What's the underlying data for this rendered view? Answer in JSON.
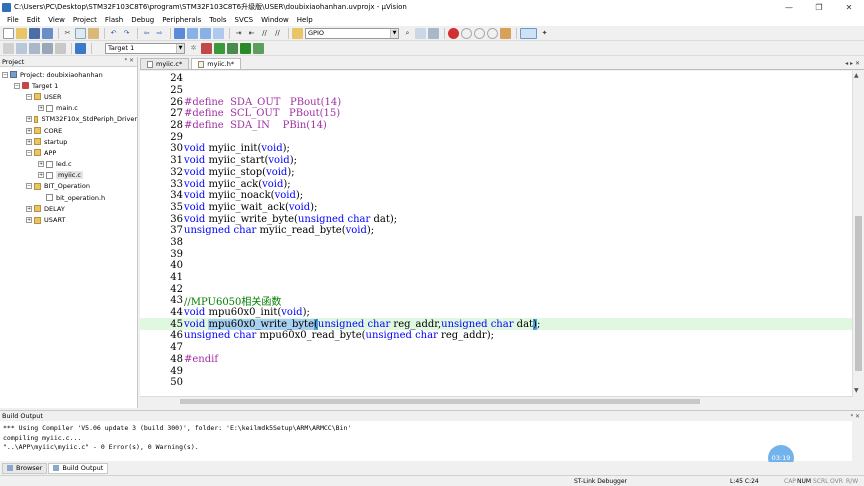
{
  "window": {
    "title": "C:\\Users\\PC\\Desktop\\STM32F103C8T6\\program\\STM32F103C8T6升级版\\USER\\doubixiaohanhan.uvprojx - µVision",
    "controls": [
      "—",
      "❐",
      "✕"
    ]
  },
  "menu": [
    "File",
    "Edit",
    "View",
    "Project",
    "Flash",
    "Debug",
    "Peripherals",
    "Tools",
    "SVCS",
    "Window",
    "Help"
  ],
  "toolbar": {
    "search_value": "GPIO",
    "target_value": "Target 1"
  },
  "project_panel": {
    "title": "Project",
    "header_buttons": "ᵠ ✕",
    "tree": [
      {
        "label": "Project: doubixiaohanhan",
        "level": 0,
        "icon": "project-icon",
        "expander": "−"
      },
      {
        "label": "Target 1",
        "level": 1,
        "icon": "target-icon",
        "expander": "−"
      },
      {
        "label": "USER",
        "level": 2,
        "icon": "folder-icon",
        "expander": "−"
      },
      {
        "label": "main.c",
        "level": 3,
        "icon": "file-icon",
        "expander": "+"
      },
      {
        "label": "STM32F10x_StdPeriph_Driver",
        "level": 2,
        "icon": "folder-icon",
        "expander": "+"
      },
      {
        "label": "CORE",
        "level": 2,
        "icon": "folder-icon",
        "expander": "+"
      },
      {
        "label": "startup",
        "level": 2,
        "icon": "folder-icon",
        "expander": "+"
      },
      {
        "label": "APP",
        "level": 2,
        "icon": "folder-icon",
        "expander": "−"
      },
      {
        "label": "led.c",
        "level": 3,
        "icon": "file-icon",
        "expander": "+"
      },
      {
        "label": "myiic.c",
        "level": 3,
        "icon": "file-icon",
        "expander": "+",
        "selected": true
      },
      {
        "label": "BIT_Operation",
        "level": 2,
        "icon": "folder-icon",
        "expander": "−"
      },
      {
        "label": "bit_operation.h",
        "level": 3,
        "icon": "file-icon",
        "expander": ""
      },
      {
        "label": "DELAY",
        "level": 2,
        "icon": "folder-icon",
        "expander": "+"
      },
      {
        "label": "USART",
        "level": 2,
        "icon": "folder-icon",
        "expander": "+"
      }
    ]
  },
  "editor": {
    "tabs": [
      {
        "label": "myiic.c*",
        "active": false
      },
      {
        "label": "myiic.h*",
        "active": true
      }
    ],
    "tab_scroll": "◂ ▸ ✕",
    "lines": [
      {
        "n": "24",
        "parts": []
      },
      {
        "n": "25",
        "parts": []
      },
      {
        "n": "26",
        "parts": [
          {
            "t": "#define  SDA_OUT   PBout(14)",
            "c": "kw2"
          }
        ]
      },
      {
        "n": "27",
        "parts": [
          {
            "t": "#define  SCL_OUT   PBout(15)",
            "c": "kw2"
          }
        ]
      },
      {
        "n": "28",
        "parts": [
          {
            "t": "#define  SDA_IN    PBin(14)",
            "c": "kw2"
          }
        ]
      },
      {
        "n": "29",
        "parts": []
      },
      {
        "n": "30",
        "parts": [
          {
            "t": "void",
            "c": "kw"
          },
          {
            "t": " myiic_init(",
            "c": ""
          },
          {
            "t": "void",
            "c": "kw"
          },
          {
            "t": ");",
            "c": ""
          }
        ]
      },
      {
        "n": "31",
        "parts": [
          {
            "t": "void",
            "c": "kw"
          },
          {
            "t": " myiic_start(",
            "c": ""
          },
          {
            "t": "void",
            "c": "kw"
          },
          {
            "t": ");",
            "c": ""
          }
        ]
      },
      {
        "n": "32",
        "parts": [
          {
            "t": "void",
            "c": "kw"
          },
          {
            "t": " myiic_stop(",
            "c": ""
          },
          {
            "t": "void",
            "c": "kw"
          },
          {
            "t": ");",
            "c": ""
          }
        ]
      },
      {
        "n": "33",
        "parts": [
          {
            "t": "void",
            "c": "kw"
          },
          {
            "t": " myiic_ack(",
            "c": ""
          },
          {
            "t": "void",
            "c": "kw"
          },
          {
            "t": ");",
            "c": ""
          }
        ]
      },
      {
        "n": "34",
        "parts": [
          {
            "t": "void",
            "c": "kw"
          },
          {
            "t": " myiic_noack(",
            "c": ""
          },
          {
            "t": "void",
            "c": "kw"
          },
          {
            "t": ");",
            "c": ""
          }
        ]
      },
      {
        "n": "35",
        "parts": [
          {
            "t": "void",
            "c": "kw"
          },
          {
            "t": " myiic_wait_ack(",
            "c": ""
          },
          {
            "t": "void",
            "c": "kw"
          },
          {
            "t": ");",
            "c": ""
          }
        ]
      },
      {
        "n": "36",
        "parts": [
          {
            "t": "void",
            "c": "kw"
          },
          {
            "t": " myiic_write_byte(",
            "c": ""
          },
          {
            "t": "unsigned char",
            "c": "kw"
          },
          {
            "t": " dat);",
            "c": ""
          }
        ]
      },
      {
        "n": "37",
        "parts": [
          {
            "t": "unsigned char",
            "c": "kw"
          },
          {
            "t": " myiic_read_byte(",
            "c": ""
          },
          {
            "t": "void",
            "c": "kw"
          },
          {
            "t": ");",
            "c": ""
          }
        ]
      },
      {
        "n": "38",
        "parts": []
      },
      {
        "n": "39",
        "parts": []
      },
      {
        "n": "40",
        "parts": []
      },
      {
        "n": "41",
        "parts": []
      },
      {
        "n": "42",
        "parts": []
      },
      {
        "n": "43",
        "parts": [
          {
            "t": "//MPU6050相关函数",
            "c": "cm"
          }
        ]
      },
      {
        "n": "44",
        "parts": [
          {
            "t": "void",
            "c": "kw"
          },
          {
            "t": " mpu60x0_init(",
            "c": ""
          },
          {
            "t": "void",
            "c": "kw"
          },
          {
            "t": ");",
            "c": ""
          }
        ]
      },
      {
        "n": "45",
        "current": true,
        "parts": [
          {
            "t": "void",
            "c": "kw"
          },
          {
            "t": " ",
            "c": ""
          },
          {
            "t": "mpu60x0_write_byte",
            "c": "sel"
          },
          {
            "t": "(",
            "c": "brace"
          },
          {
            "t": "unsigned char",
            "c": "kw"
          },
          {
            "t": " reg_addr,",
            "c": ""
          },
          {
            "t": "unsigned char",
            "c": "kw"
          },
          {
            "t": " dat",
            "c": ""
          },
          {
            "t": ")",
            "c": "brace"
          },
          {
            "t": ";",
            "c": ""
          }
        ]
      },
      {
        "n": "46",
        "parts": [
          {
            "t": "unsigned char",
            "c": "kw"
          },
          {
            "t": " mpu60x0_read_byte(",
            "c": ""
          },
          {
            "t": "unsigned char",
            "c": "kw"
          },
          {
            "t": " reg_addr);",
            "c": ""
          }
        ]
      },
      {
        "n": "47",
        "parts": []
      },
      {
        "n": "48",
        "parts": [
          {
            "t": "#endif",
            "c": "kw2"
          }
        ]
      },
      {
        "n": "49",
        "parts": []
      },
      {
        "n": "50",
        "parts": []
      }
    ]
  },
  "build_output": {
    "title": "Build Output",
    "header_buttons": "ᵠ ✕",
    "lines": [
      "*** Using Compiler 'V5.06 update 3 (build 300)', folder: 'E:\\keilmdk5Setup\\ARM\\ARMCC\\Bin'",
      "compiling myiic.c...",
      "\"..\\APP\\myiic\\myiic.c\" - 0 Error(s), 0 Warning(s)."
    ],
    "time_badge": "03:19"
  },
  "bottom_tabs": [
    {
      "label": "Browser",
      "active": false
    },
    {
      "label": "Build Output",
      "active": true
    }
  ],
  "status": {
    "debugger": "ST-Link Debugger",
    "position": "L:45 C:24",
    "indicators": [
      {
        "label": "CAP",
        "active": false
      },
      {
        "label": "NUM",
        "active": true
      },
      {
        "label": "SCRL",
        "active": false
      },
      {
        "label": "OVR",
        "active": false
      },
      {
        "label": "R/W",
        "active": false
      }
    ]
  }
}
